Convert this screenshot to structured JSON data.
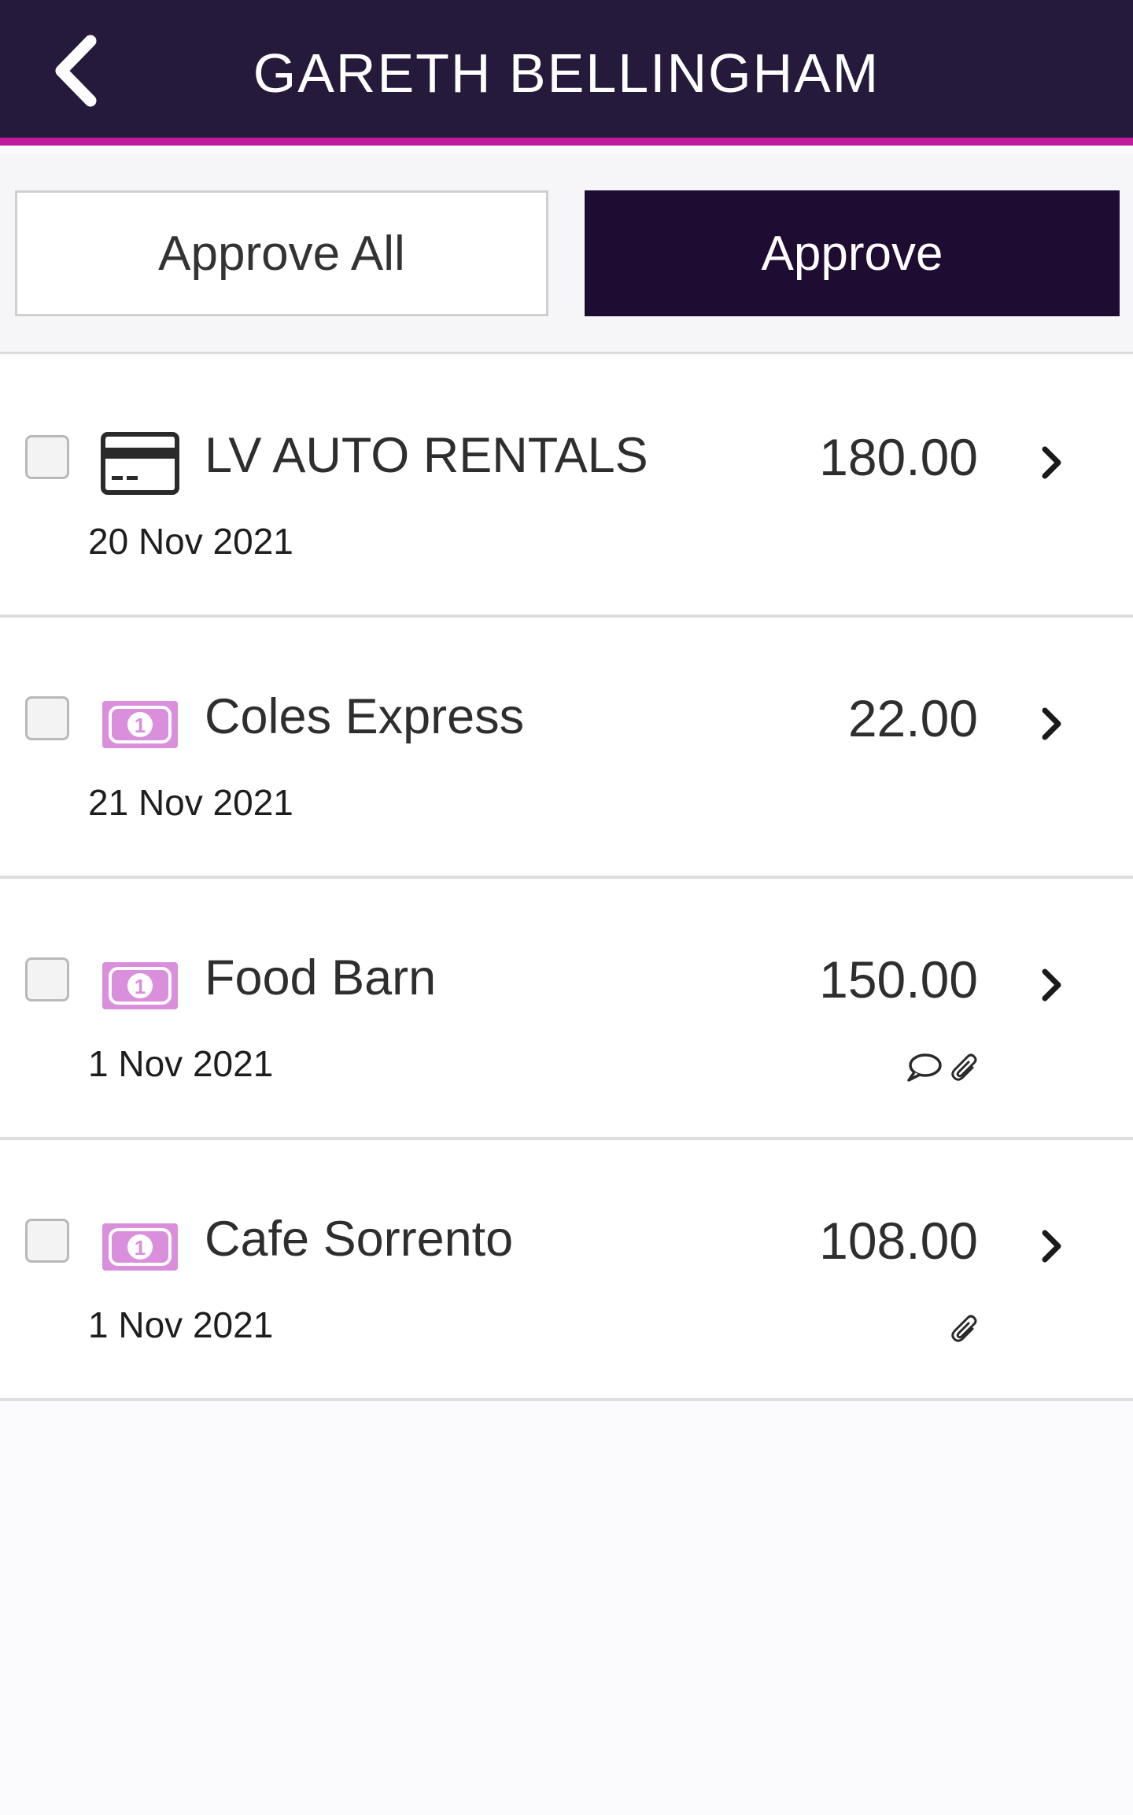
{
  "header": {
    "title": "GARETH BELLINGHAM"
  },
  "actions": {
    "approve_all_label": "Approve All",
    "approve_label": "Approve"
  },
  "colors": {
    "header_bg": "#261a3c",
    "accent": "#c21c9e",
    "primary_button": "#1e0c33",
    "cash_icon": "#d98fdc"
  },
  "transactions": [
    {
      "merchant": "LV AUTO RENTALS",
      "date": "20 Nov 2021",
      "amount": "180.00",
      "type_icon": "credit-card-icon",
      "has_comment": false,
      "has_attachment": false
    },
    {
      "merchant": "Coles Express",
      "date": "21 Nov 2021",
      "amount": "22.00",
      "type_icon": "cash-icon",
      "has_comment": false,
      "has_attachment": false
    },
    {
      "merchant": "Food Barn",
      "date": "1 Nov 2021",
      "amount": "150.00",
      "type_icon": "cash-icon",
      "has_comment": true,
      "has_attachment": true
    },
    {
      "merchant": "Cafe Sorrento",
      "date": "1 Nov 2021",
      "amount": "108.00",
      "type_icon": "cash-icon",
      "has_comment": false,
      "has_attachment": true
    }
  ]
}
